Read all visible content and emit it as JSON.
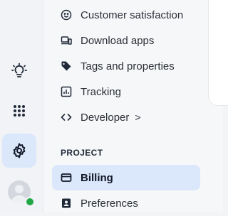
{
  "rail": {
    "items": [
      {
        "icon": "lightbulb-icon"
      },
      {
        "icon": "apps-grid-icon"
      },
      {
        "icon": "gear-icon",
        "active": true
      }
    ],
    "presence_color": "#22a745",
    "accent": "#dbe7fb"
  },
  "nav": {
    "items": [
      {
        "label": "Customer satisfaction",
        "icon": "smiley-icon"
      },
      {
        "label": "Download apps",
        "icon": "devices-icon"
      },
      {
        "label": "Tags and properties",
        "icon": "tag-icon"
      },
      {
        "label": "Tracking",
        "icon": "chart-icon"
      },
      {
        "label": "Developer",
        "icon": "code-icon",
        "chevron": ">"
      }
    ],
    "section_label": "PROJECT",
    "project_items": [
      {
        "label": "Billing",
        "icon": "credit-card-icon",
        "active": true
      },
      {
        "label": "Preferences",
        "icon": "profile-card-icon"
      }
    ]
  }
}
